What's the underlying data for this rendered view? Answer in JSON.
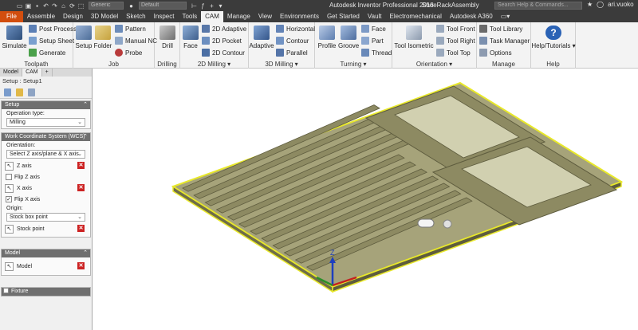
{
  "title_bar": {
    "file_icon": "inventor-logo-icon",
    "combo1": "Generic",
    "combo2": "Default",
    "app_title": "Autodesk Inventor Professional 2018",
    "document": "ShoeRackAssembly",
    "search_placeholder": "Search Help & Commands...",
    "user": "ari.vuoko"
  },
  "tabs": [
    "File",
    "Assemble",
    "Design",
    "3D Model",
    "Sketch",
    "Inspect",
    "Tools",
    "CAM",
    "Manage",
    "View",
    "Environments",
    "Get Started",
    "Vault",
    "Electromechanical",
    "Autodesk A360"
  ],
  "active_tab": "CAM",
  "ribbon": {
    "toolpath": {
      "title": "Toolpath",
      "simulate": "Simulate",
      "post_process": "Post Process",
      "setup_sheet": "Setup Sheet",
      "generate": "Generate"
    },
    "job": {
      "title": "Job",
      "setup": "Setup",
      "folder": "Folder",
      "pattern": "Pattern",
      "manual_nc": "Manual NC",
      "probe": "Probe"
    },
    "drilling": {
      "title": "Drilling",
      "drill": "Drill"
    },
    "milling2d": {
      "title": "2D Milling ▾",
      "face": "Face",
      "adaptive": "2D Adaptive",
      "pocket": "2D Pocket",
      "contour": "2D Contour"
    },
    "milling3d": {
      "title": "3D Milling ▾",
      "adaptive": "Adaptive",
      "horizontal": "Horizontal",
      "contour": "Contour",
      "parallel": "Parallel"
    },
    "turning": {
      "title": "Turning ▾",
      "profile": "Profile",
      "groove": "Groove",
      "face": "Face",
      "part": "Part",
      "thread": "Thread"
    },
    "orientation": {
      "title": "Orientation ▾",
      "tool_isometric": "Tool Isometric",
      "tool_front": "Tool Front",
      "tool_right": "Tool Right",
      "tool_top": "Tool Top"
    },
    "manage": {
      "title": "Manage",
      "tool_library": "Tool Library",
      "task_manager": "Task Manager",
      "options": "Options"
    },
    "help": {
      "title": "Help",
      "help_tutorials": "Help/Tutorials ▾"
    }
  },
  "browser": {
    "tabs": [
      "Model",
      "CAM",
      "+"
    ],
    "setup_line": "Setup : Setup1",
    "setup_section": {
      "title": "Setup",
      "operation_type_label": "Operation type:",
      "operation_type_value": "Milling"
    },
    "wcs_section": {
      "title": "Work Coordinate System (WCS)",
      "orientation_label": "Orientation:",
      "orientation_value": "Select Z axis/plane & X axis",
      "z_axis": "Z axis",
      "flip_z": "Flip Z axis",
      "flip_z_checked": false,
      "x_axis": "X axis",
      "flip_x": "Flip X axis",
      "flip_x_checked": true,
      "origin_label": "Origin:",
      "origin_value": "Stock box point",
      "stock_point": "Stock point"
    },
    "model_section": {
      "title": "Model",
      "model": "Model"
    },
    "fixture": "Fixture"
  },
  "viewport": {
    "axis_z": "Z",
    "colors": {
      "panel": "#8d8a62",
      "panel_top": "#a6a37a",
      "panel_dark": "#5e5c3e",
      "highlight": "#e8e82a",
      "triad_z": "#1d3fbf",
      "triad_x": "#c42020",
      "triad_y": "#2a8f2a"
    }
  }
}
